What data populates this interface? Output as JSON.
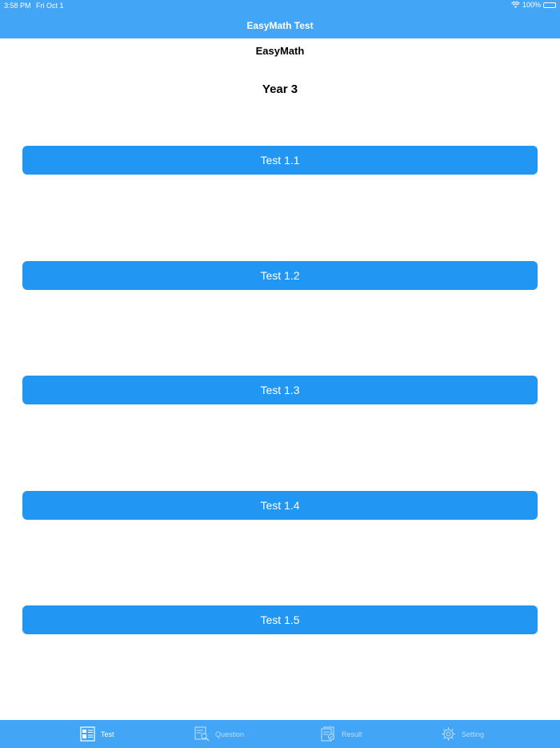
{
  "status_bar": {
    "time": "3:58 PM",
    "date": "Fri Oct 1",
    "battery": "100%",
    "wifi_icon": "wifi-icon",
    "battery_icon": "battery-icon"
  },
  "nav": {
    "title": "EasyMath Test"
  },
  "header": {
    "app_name": "EasyMath",
    "year": "Year 3"
  },
  "tests": [
    "Test 1.1",
    "Test 1.2",
    "Test 1.3",
    "Test 1.4",
    "Test 1.5"
  ],
  "colors": {
    "bar": "#42a5f5",
    "button": "#2196f3"
  },
  "tabs": [
    {
      "label": "Test",
      "icon": "test-list-icon",
      "active": true
    },
    {
      "label": "Question",
      "icon": "question-search-icon",
      "active": false
    },
    {
      "label": "Result",
      "icon": "result-document-icon",
      "active": false
    },
    {
      "label": "Setting",
      "icon": "gear-icon",
      "active": false
    }
  ]
}
